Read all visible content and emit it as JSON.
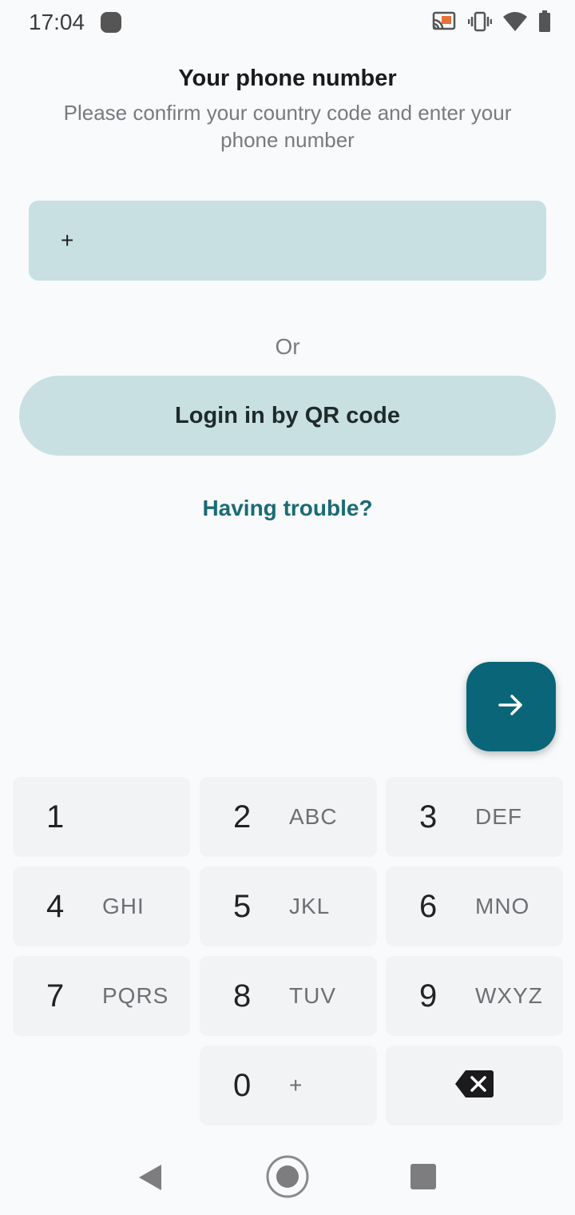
{
  "status_bar": {
    "time": "17:04",
    "icons": [
      "cast-icon",
      "vibrate-icon",
      "wifi-icon",
      "battery-icon"
    ]
  },
  "header": {
    "title": "Your phone number",
    "subtitle": "Please confirm your country code and enter your phone number"
  },
  "phone_field": {
    "prefix": "+",
    "value": "",
    "placeholder": ""
  },
  "divider_text": "Or",
  "qr_button_label": "Login in by QR code",
  "trouble_link": "Having trouble?",
  "fab_icon": "arrow-right-icon",
  "keypad": {
    "keys": [
      {
        "digit": "1",
        "letters": ""
      },
      {
        "digit": "2",
        "letters": "ABC"
      },
      {
        "digit": "3",
        "letters": "DEF"
      },
      {
        "digit": "4",
        "letters": "GHI"
      },
      {
        "digit": "5",
        "letters": "JKL"
      },
      {
        "digit": "6",
        "letters": "MNO"
      },
      {
        "digit": "7",
        "letters": "PQRS"
      },
      {
        "digit": "8",
        "letters": "TUV"
      },
      {
        "digit": "9",
        "letters": "WXYZ"
      },
      {
        "digit": "0",
        "letters": "+"
      }
    ],
    "backspace_icon": "backspace-icon"
  },
  "nav_bar": {
    "icons": [
      "back-icon",
      "home-icon",
      "recent-apps-icon"
    ]
  },
  "colors": {
    "accent": "#0a6578",
    "field_bg": "#c8e0e2",
    "link": "#1a6b74"
  }
}
